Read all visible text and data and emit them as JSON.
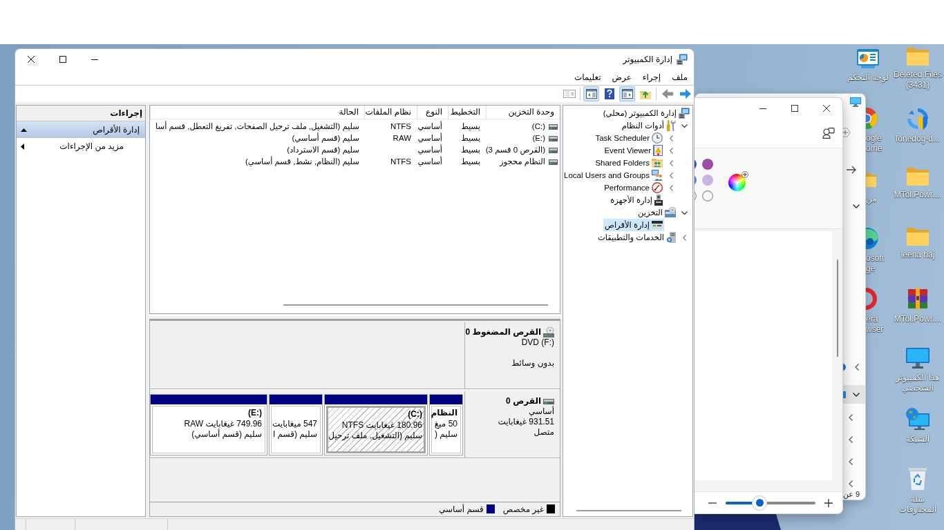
{
  "window": {
    "title": "إدارة الكمبيوتر"
  },
  "menu": [
    "ملف",
    "إجراء",
    "عرض",
    "تعليمات"
  ],
  "toolbar": [
    [
      {
        "kind": "forward",
        "disabled": false,
        "pressed": false
      },
      {
        "kind": "back",
        "disabled": true,
        "pressed": false
      }
    ],
    [
      {
        "kind": "up",
        "disabled": false,
        "pressed": false
      },
      {
        "kind": "tree",
        "disabled": false,
        "pressed": true
      },
      {
        "kind": "help",
        "disabled": false,
        "pressed": false
      },
      {
        "kind": "actions",
        "disabled": false,
        "pressed": true
      }
    ],
    [
      {
        "kind": "export",
        "disabled": true,
        "pressed": false
      }
    ]
  ],
  "tree": [
    {
      "label": "إدارة الكمبيوتر (محلي)",
      "kind": "computer",
      "selected": false,
      "children": [
        {
          "label": "أدوات النظام",
          "kind": "tools",
          "expanded": true,
          "selected": false,
          "children": [
            {
              "label": "Task Scheduler",
              "kind": "clock",
              "expanded": false,
              "selected": false
            },
            {
              "label": "Event Viewer",
              "kind": "log",
              "expanded": false,
              "selected": false
            },
            {
              "label": "Shared Folders",
              "kind": "share",
              "expanded": false,
              "selected": false
            },
            {
              "label": "Local Users and Groups",
              "kind": "users",
              "expanded": false,
              "selected": false
            },
            {
              "label": "Performance",
              "kind": "gauge",
              "expanded": false,
              "selected": false
            },
            {
              "label": "إدارة الأجهزة",
              "kind": "device",
              "selected": false
            }
          ]
        },
        {
          "label": "التخزين",
          "kind": "storage",
          "expanded": true,
          "selected": false,
          "children": [
            {
              "label": "إدارة الأقراص",
              "kind": "disk",
              "selected": true
            }
          ]
        },
        {
          "label": "الخدمات والتطبيقات",
          "kind": "services",
          "expanded": false,
          "selected": false
        }
      ]
    }
  ],
  "volumes": {
    "columns": [
      "وحدة التخزين",
      "التخطيط",
      "النوع",
      "نظام الملفات",
      "الحالة"
    ],
    "rows": [
      {
        "volume": "(C:)",
        "layout": "بسيط",
        "type": "أساسي",
        "file_system": "NTFS",
        "status": "سليم (التشغيل, ملف ترحيل الصفحات, تفريغ التعطل, قسم أسا"
      },
      {
        "volume": "(E:)",
        "layout": "بسيط",
        "type": "أساسي",
        "file_system": "RAW",
        "status": "سليم (قسم أساسي)"
      },
      {
        "volume": "(القرص 0 قسم 3)",
        "layout": "بسيط",
        "type": "أساسي",
        "status": "سليم (قسم الاسترداد)"
      },
      {
        "volume": "النظام محجوز",
        "layout": "بسيط",
        "type": "أساسي",
        "file_system": "NTFS",
        "status": "سليم (النظام, نشط, قسم أساسي)"
      }
    ]
  },
  "disks": [
    {
      "kind": "cdrom",
      "name": "القرص المضغوط 0",
      "subtitle": "DVD (F:)",
      "status": "بدون وسائط"
    },
    {
      "kind": "disk",
      "name": "القرص 0",
      "subtitle": "أساسي",
      "size": "931.51 غيغابايت",
      "status": "متصل",
      "partitions": [
        {
          "label": "النظام",
          "size": "50 ميغ",
          "status": "سليم (",
          "color": "#000080",
          "selected": false
        },
        {
          "label": "(C:)",
          "size": "180.96 غيغابايت NTFS",
          "status": "سليم (التشغيل, ملف ترحيل",
          "color": "#000080",
          "selected": true
        },
        {
          "size": "547 ميغابايت",
          "status": "سليم (قسم ا",
          "color": "#000080",
          "selected": false
        },
        {
          "label": "(E:)",
          "size": "749.96 غيغابايت RAW",
          "status": "سليم (قسم أساسي)",
          "color": "#000080",
          "selected": false
        }
      ]
    }
  ],
  "legend": [
    {
      "label": "غير مخصص",
      "color": "#000000"
    },
    {
      "label": "قسم أساسي",
      "color": "#000080"
    }
  ],
  "actions": {
    "title": "إجراءات",
    "items": [
      {
        "label": "إدارة الأقراص",
        "kind": "section",
        "selected": true
      },
      {
        "label": "مزيد من الإجراءات",
        "kind": "submenu",
        "selected": false
      }
    ]
  },
  "paint_window": {
    "palette": [
      {
        "filled": true,
        "color": "#3c4ea3"
      },
      {
        "filled": true,
        "color": "#9e4aa7"
      },
      {
        "filled": true,
        "color": "#6383b8"
      },
      {
        "filled": true,
        "color": "#c6b6e1"
      },
      {
        "filled": false
      },
      {
        "filled": false
      }
    ],
    "zoom_slider": {
      "level": 0.38
    }
  },
  "explorer_window": {
    "nav": [
      {
        "expanded": false,
        "selected": false
      },
      {
        "expanded": true,
        "selected": true,
        "children": [
          {
            "expanded": false,
            "selected": false
          },
          {
            "expanded": false,
            "selected": false
          },
          {
            "expanded": false,
            "selected": false
          },
          {
            "expanded": false,
            "selected": false
          }
        ]
      }
    ],
    "footer": "9 عن"
  },
  "desktop": {
    "right_column": [
      {
        "label": "Deleted Files (3431)",
        "kind": "folder"
      },
      {
        "label": "fonedog-d...",
        "kind": "sync"
      },
      {
        "label": "MTol.Powr....",
        "kind": "folder"
      },
      {
        "label": "leena haj",
        "kind": "folder"
      },
      {
        "label": "MTol.Powr....",
        "kind": "archive"
      },
      {
        "label": "هذا الكمبيوتر الشخصي",
        "kind": "computer"
      },
      {
        "label": "الشبكة",
        "kind": "network"
      },
      {
        "label": "سلة المحذوفات",
        "kind": "recycle"
      }
    ],
    "left_column": [
      {
        "label": "لوحة التحكم",
        "kind": "control-panel"
      },
      {
        "label": "ogle ome",
        "kind": "partial-circle"
      },
      {
        "label": "من",
        "kind": "partial-folder"
      },
      {
        "label": "osoft ge",
        "kind": "partial-swirl"
      },
      {
        "label": "era wser",
        "kind": "partial-ring"
      }
    ]
  }
}
